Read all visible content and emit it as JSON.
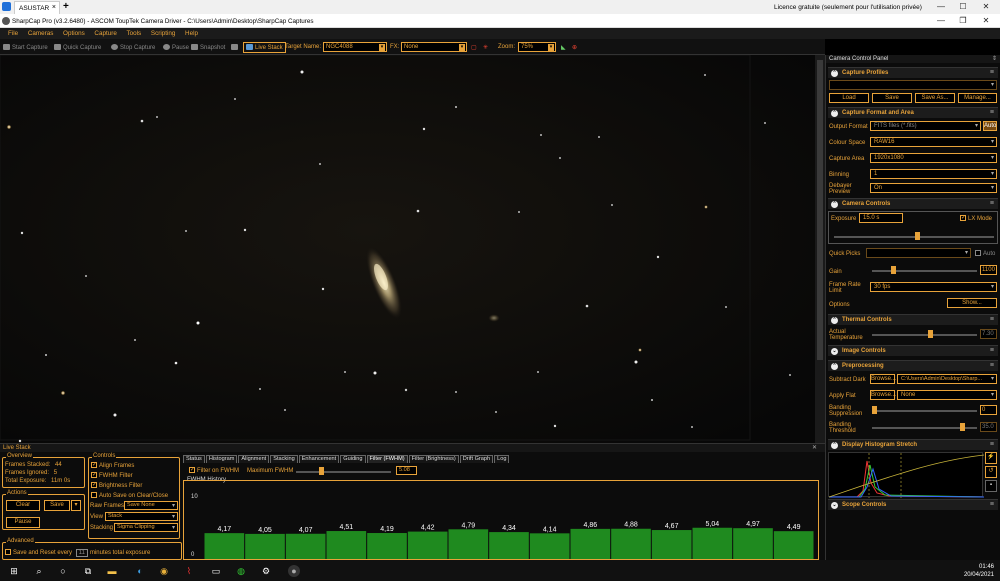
{
  "top_bar": {
    "tab_label": "ASUSTAR",
    "close": "×",
    "plus": "+",
    "license_text": "Licence gratuite (seulement pour l'utilisation privée)"
  },
  "window": {
    "title": "SharpCap Pro (v3.2.6480) - ASCOM ToupTek Camera Driver - C:\\Users\\Admin\\Desktop\\SharpCap Captures"
  },
  "menu": [
    "File",
    "Cameras",
    "Options",
    "Capture",
    "Tools",
    "Scripting",
    "Help"
  ],
  "toolbar": {
    "start_capture": "Start Capture",
    "quick_capture": "Quick Capture",
    "stop_capture": "Stop Capture",
    "pause": "Pause",
    "snapshot": "Snapshot",
    "live_stack": "Live Stack",
    "target_name_label": "Target Name:",
    "target_name_value": "NGC4088",
    "fx_label": "FX:",
    "fx_value": "None",
    "zoom_label": "Zoom:",
    "zoom_value": "75%"
  },
  "live_stack": {
    "title": "Live Stack",
    "overview": {
      "legend": "Overview",
      "frames_stacked_label": "Frames Stacked:",
      "frames_stacked": "44",
      "frames_ignored_label": "Frames Ignored:",
      "frames_ignored": "5",
      "total_exposure_label": "Total Exposure:",
      "total_exposure": "11m 0s"
    },
    "actions": {
      "legend": "Actions",
      "clear": "Clear",
      "save": "Save",
      "pause": "Pause"
    },
    "advanced": {
      "legend": "Advanced",
      "save_reset_label": "Save and Reset every",
      "minutes_value": "11",
      "minutes_label": "minutes total exposure"
    },
    "controls": {
      "legend": "Controls",
      "align_frames": "Align Frames",
      "fwhm_filter": "FWHM Filter",
      "brightness_filter": "Brightness Filter",
      "auto_save": "Auto Save on Clear/Close",
      "raw_frames_label": "Raw Frames",
      "raw_frames_value": "Save None",
      "view_label": "View",
      "view_value": "Stack",
      "stacking_label": "Stacking",
      "stacking_value": "Sigma Clipping"
    },
    "tabs": [
      "Status",
      "Histogram",
      "Alignment",
      "Stacking",
      "Enhancement",
      "Guiding",
      "Filter (FWHM)",
      "Filter (Brightness)",
      "Drift Graph",
      "Log"
    ],
    "filter": {
      "filter_on_label": "Filter on FWHM",
      "maximum_label": "Maximum FWHM",
      "maximum_value": "5.08"
    },
    "history_label": "FWHM History"
  },
  "chart_data": {
    "type": "bar",
    "title": "FWHM History",
    "y_tick_labels": [
      "10",
      "0"
    ],
    "ylim": [
      0,
      10
    ],
    "values": [
      4.17,
      4.05,
      4.07,
      4.51,
      4.19,
      4.42,
      4.79,
      4.34,
      4.14,
      4.86,
      4.88,
      4.67,
      5.04,
      4.97,
      4.49
    ],
    "labels": [
      "4,17",
      "4,05",
      "4,07",
      "4,51",
      "4,19",
      "4,42",
      "4,79",
      "4,34",
      "4,14",
      "4,86",
      "4,88",
      "4,67",
      "5,04",
      "4,97",
      "4,49"
    ],
    "bar_color": "#1f8a1f"
  },
  "camera_panel": {
    "title": "Camera Control Panel",
    "sections": {
      "profiles": "Capture Profiles",
      "format": "Capture Format and Area",
      "controls": "Camera Controls",
      "thermal": "Thermal Controls",
      "image": "Image Controls",
      "preprocessing": "Preprocessing",
      "histogram": "Display Histogram Stretch",
      "scope": "Scope Controls"
    },
    "profile_buttons": [
      "Load",
      "Save",
      "Save As...",
      "Manage..."
    ],
    "output_format_label": "Output Format",
    "output_format": "FITS files (*.fits)",
    "auto": "Auto",
    "colour_space_label": "Colour Space",
    "colour_space": "RAW16",
    "capture_area_label": "Capture Area",
    "capture_area": "1920x1080",
    "binning_label": "Binning",
    "binning": "1",
    "debayer_label": "Debayer Preview",
    "debayer": "On",
    "exposure_label": "Exposure",
    "exposure": "15.0 s",
    "lx_mode": "LX Mode",
    "exposure_level": 0.52,
    "quick_picks_label": "Quick Picks",
    "gain_label": "Gain",
    "gain": "1100",
    "gain_level": 0.2,
    "frame_rate_label": "Frame Rate Limit",
    "frame_rate": "30 fps",
    "options_label": "Options",
    "show": "Show...",
    "actual_temp_label": "Actual Temperature",
    "actual_temp": "7.30",
    "temp_level": 0.55,
    "subtract_dark_label": "Subtract Dark",
    "browse": "Browse...",
    "dark_path": "C:\\Users\\Admin\\Desktop\\Sharp...",
    "apply_flat_label": "Apply Flat",
    "flat_value": "None",
    "banding_suppression_label": "Banding Suppression",
    "banding_suppression": "0",
    "banding_threshold_label": "Banding Threshold",
    "banding_threshold": "35.0"
  },
  "taskbar": {
    "time": "01:46",
    "date": "20/04/2021"
  }
}
